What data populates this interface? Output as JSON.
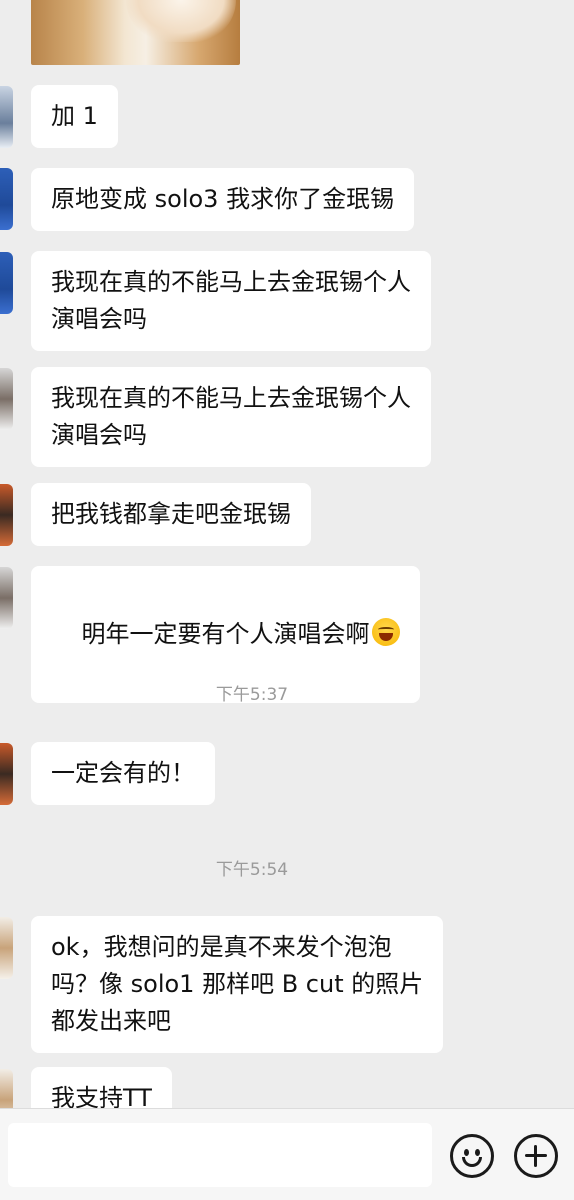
{
  "messages": [
    {
      "text": "加 1"
    },
    {
      "text": "原地变成 solo3 我求你了金珉锡"
    },
    {
      "text": "我现在真的不能马上去金珉锡个人\n演唱会吗"
    },
    {
      "text": "我现在真的不能马上去金珉锡个人\n演唱会吗"
    },
    {
      "text": "把我钱都拿走吧金珉锡"
    },
    {
      "text": "明年一定要有个人演唱会啊",
      "emoji": "laughing-crying-emoji"
    },
    {
      "text": "一定会有的！"
    },
    {
      "text": "ok，我想问的是真不来发个泡泡\n吗？像 solo1 那样吧 B cut 的照片\n都发出来吧"
    },
    {
      "text": "我支持TT"
    }
  ],
  "timestamps": [
    {
      "text": "下午5:37"
    },
    {
      "text": "下午5:54"
    }
  ],
  "input_bar": {
    "placeholder": "",
    "emoji_icon": "smile-icon",
    "plus_icon": "plus-icon"
  },
  "colors": {
    "background": "#ededed",
    "bubble": "#ffffff",
    "timestamp": "#9a9a9a"
  }
}
